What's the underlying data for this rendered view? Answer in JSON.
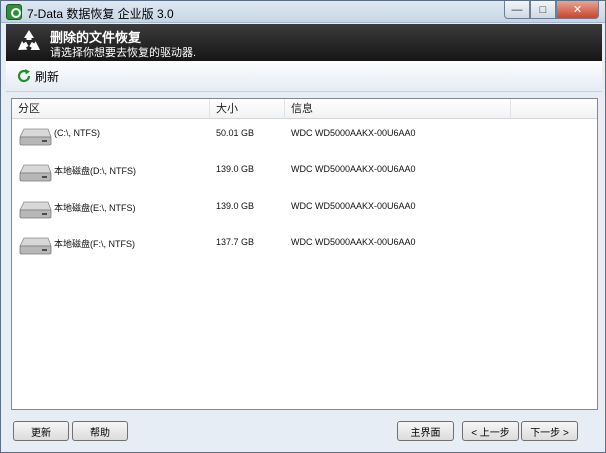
{
  "window": {
    "title": "7-Data 数据恢复 企业版 3.0",
    "controls": {
      "minimize": "—",
      "maximize": "□",
      "close": "✕"
    }
  },
  "header": {
    "title": "删除的文件恢复",
    "subtitle": "请选择你想要去恢复的驱动器."
  },
  "toolbar": {
    "refresh_label": "刷新"
  },
  "list": {
    "columns": [
      "分区",
      "大小",
      "信息"
    ],
    "rows": [
      {
        "partition": "(C:\\, NTFS)",
        "size": "50.01 GB",
        "info": "WDC WD5000AAKX-00U6AA0"
      },
      {
        "partition": "本地磁盘(D:\\, NTFS)",
        "size": "139.0 GB",
        "info": "WDC WD5000AAKX-00U6AA0"
      },
      {
        "partition": "本地磁盘(E:\\, NTFS)",
        "size": "139.0 GB",
        "info": "WDC WD5000AAKX-00U6AA0"
      },
      {
        "partition": "本地磁盘(F:\\, NTFS)",
        "size": "137.7 GB",
        "info": "WDC WD5000AAKX-00U6AA0"
      }
    ]
  },
  "footer": {
    "update_label": "更新",
    "help_label": "帮助",
    "home_label": "主界面",
    "prev_label": "< 上一步",
    "next_label": "下一步 >"
  }
}
